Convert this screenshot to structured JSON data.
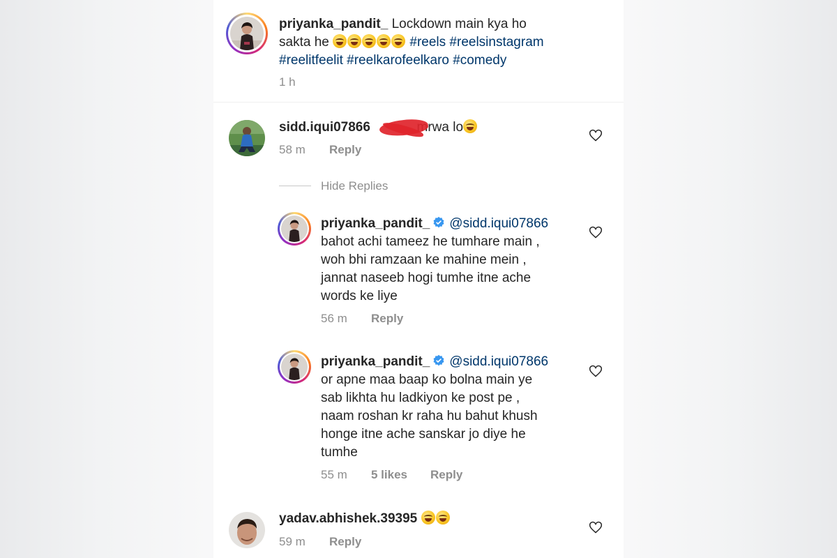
{
  "caption": {
    "username": "priyanka_pandit_",
    "line1_text": "Lockdown main kya ho",
    "line2_text": "sakta he",
    "line2_tags": "#reels #reelsinstagram",
    "line3_tags": "#reelitfeelit #reelkarofeelkaro #comedy",
    "emoji_count": 5,
    "time": "1 h"
  },
  "comments": [
    {
      "username": "sidd.iqui07866",
      "text": "mrwa lo",
      "time": "58 m",
      "reply_label": "Reply",
      "redacted": true
    }
  ],
  "hide_replies_label": "Hide Replies",
  "replies": [
    {
      "username": "priyanka_pandit_",
      "verified": true,
      "mention": "@sidd.iqui07866",
      "lines": [
        "bahot achi tameez he tumhare main ,",
        "woh bhi ramzaan ke mahine mein ,",
        "jannat naseeb hogi tumhe itne ache",
        "words ke liye"
      ],
      "time": "56 m",
      "reply_label": "Reply"
    },
    {
      "username": "priyanka_pandit_",
      "verified": true,
      "mention": "@sidd.iqui07866",
      "lines": [
        "or apne maa baap ko bolna main ye",
        "sab likhta hu ladkiyon ke post pe ,",
        "naam roshan kr raha hu bahut khush",
        "honge itne ache sanskar jo diye he",
        "tumhe"
      ],
      "time": "55 m",
      "likes": "5 likes",
      "reply_label": "Reply"
    }
  ],
  "last_comment": {
    "username": "yadav.abhishek.39395",
    "emoji_count": 2,
    "time": "59 m",
    "reply_label": "Reply"
  },
  "colors": {
    "text": "#262626",
    "meta": "#8e8e8e",
    "hashtag": "#00376b",
    "verified": "#3897f0"
  },
  "icons": [
    "heart-icon",
    "verified-badge-icon",
    "laughing-emoji-icon"
  ]
}
